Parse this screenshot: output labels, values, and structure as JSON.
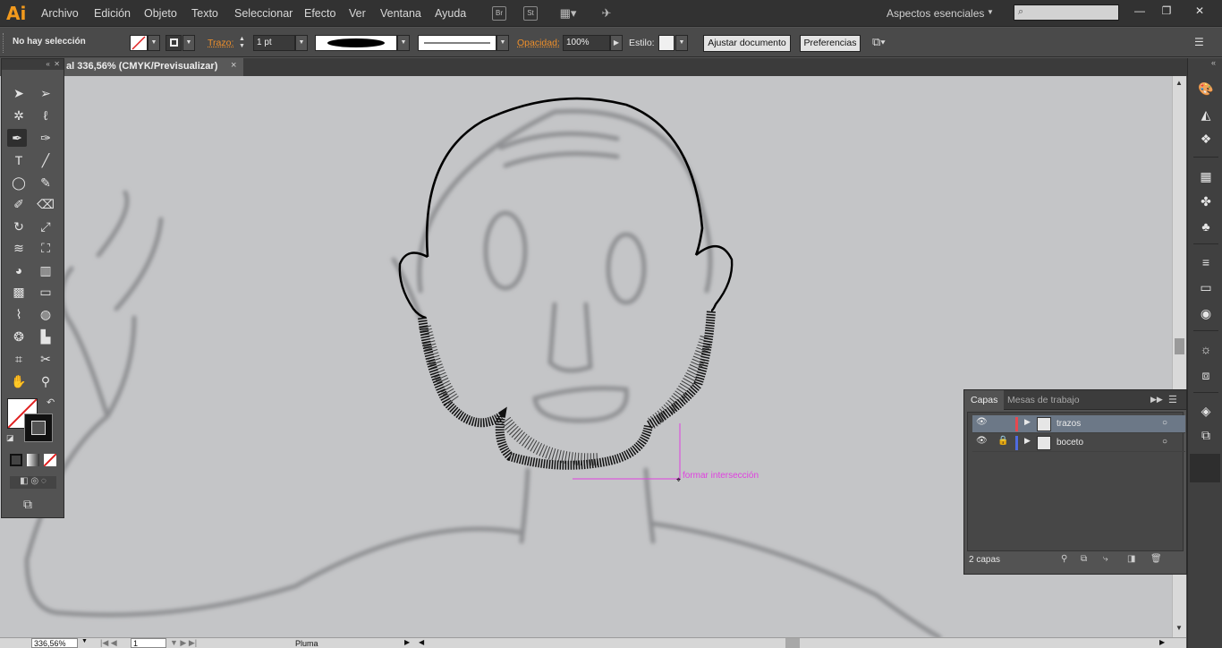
{
  "app": {
    "logo": "Ai",
    "menu": [
      "Archivo",
      "Edición",
      "Objeto",
      "Texto",
      "Seleccionar",
      "Efecto",
      "Ver",
      "Ventana",
      "Ayuda"
    ],
    "bridge_icon": "Br",
    "stock_icon": "St",
    "workspace": "Aspectos esenciales",
    "window_buttons": [
      "—",
      "❐",
      "✕"
    ]
  },
  "control": {
    "selection": "No hay selección",
    "stroke_label": "Trazo:",
    "stroke_value": "1 pt",
    "opacity_label": "Opacidad:",
    "opacity_value": "100%",
    "style_label": "Estilo:",
    "fit_button": "Ajustar documento",
    "prefs_button": "Preferencias"
  },
  "document": {
    "tab_label": "al 336,56% (CMYK/Previsualizar)",
    "close": "×",
    "smart_guide": "formar intersección"
  },
  "status": {
    "zoom": "336,56%",
    "artboard": "1",
    "tool": "Pluma"
  },
  "layers_panel": {
    "tabs": [
      "Capas",
      "Mesas de trabajo"
    ],
    "layers": [
      {
        "name": "trazos",
        "color": "#e8484f",
        "selected": true,
        "locked": false
      },
      {
        "name": "boceto",
        "color": "#4f6be0",
        "selected": false,
        "locked": true
      }
    ],
    "count": "2 capas"
  },
  "colors": {
    "menubar": "#323232",
    "panel": "#535353",
    "accent": "#f0902a",
    "smart_guide": "#e040e0",
    "selected_layer": "#6c7887"
  }
}
